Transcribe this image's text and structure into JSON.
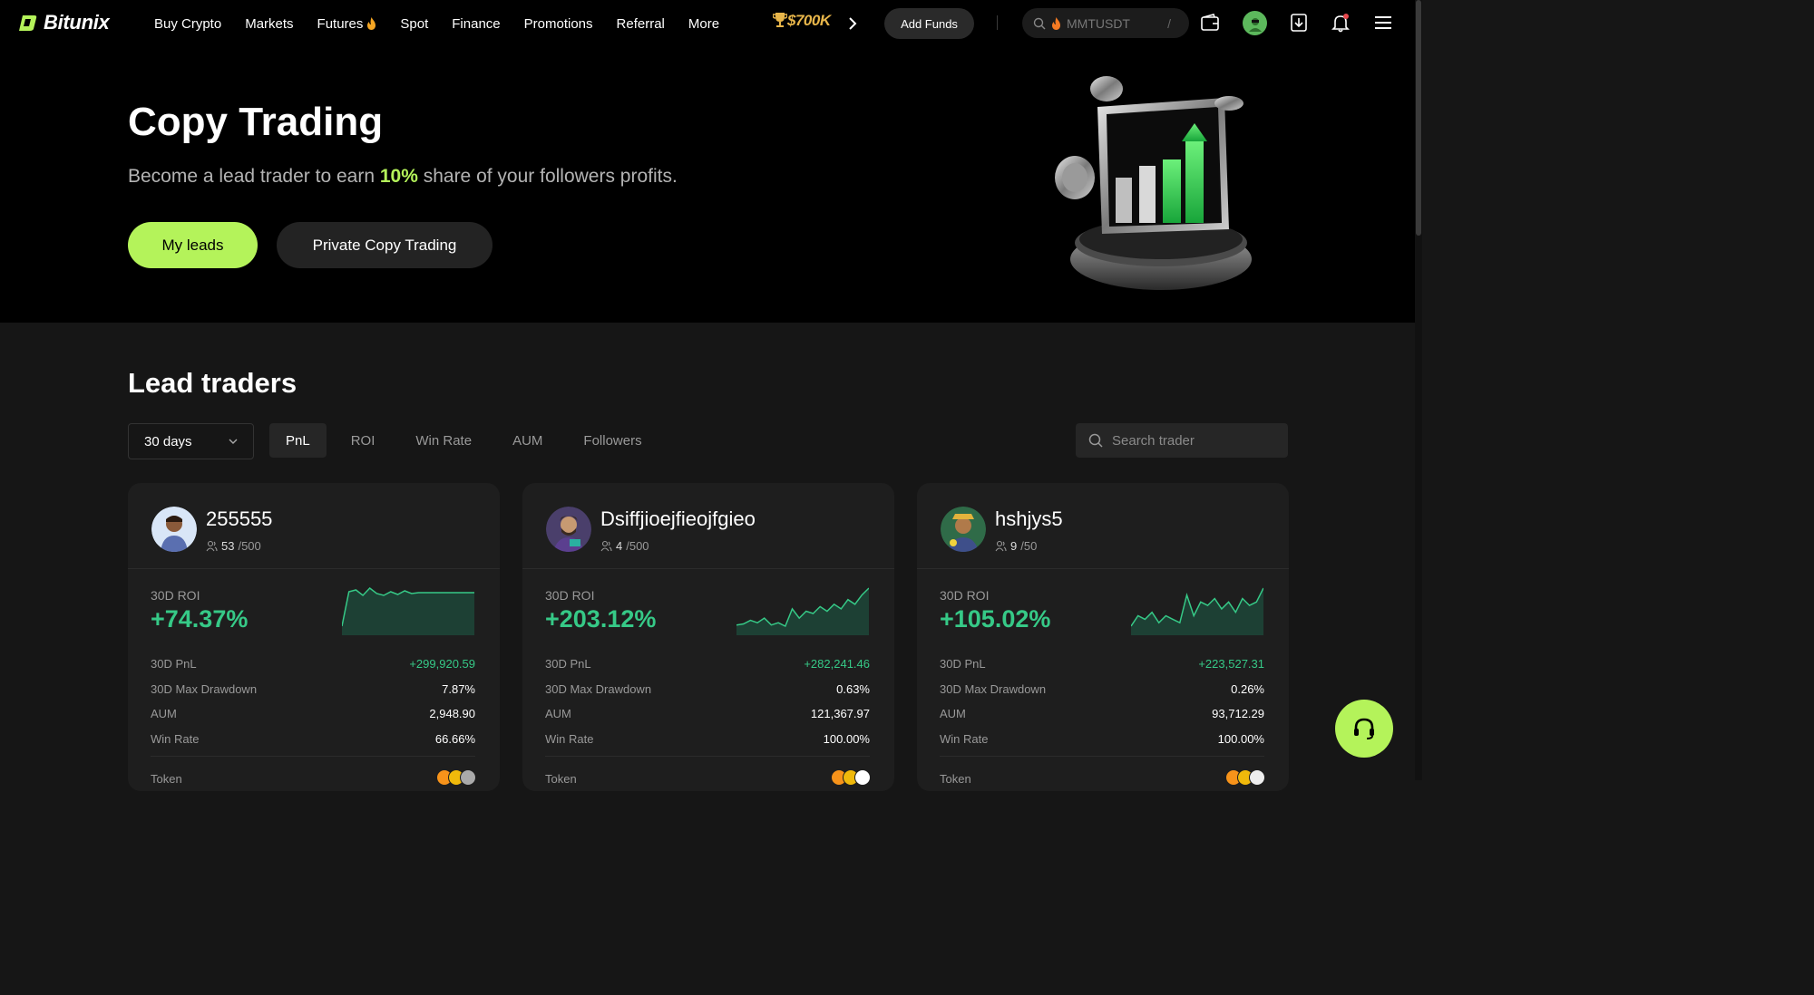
{
  "brand": {
    "name": "Bitunix"
  },
  "nav": {
    "items": [
      {
        "label": "Buy Crypto"
      },
      {
        "label": "Markets"
      },
      {
        "label": "Futures",
        "badge_icon": "fire-icon"
      },
      {
        "label": "Spot"
      },
      {
        "label": "Finance"
      },
      {
        "label": "Promotions"
      },
      {
        "label": "Referral"
      },
      {
        "label": "More"
      }
    ],
    "promo_text": "$700K",
    "add_funds_label": "Add Funds",
    "search_placeholder": "MMTUSDT",
    "search_shortcut": "/"
  },
  "hero": {
    "title": "Copy Trading",
    "subtitle_prefix": "Become a lead trader to earn ",
    "subtitle_highlight": "10%",
    "subtitle_suffix": " share of your followers profits.",
    "my_leads_label": "My leads",
    "private_label": "Private Copy Trading"
  },
  "lead_traders": {
    "title": "Lead traders",
    "period": "30 days",
    "tabs": [
      "PnL",
      "ROI",
      "Win Rate",
      "AUM",
      "Followers"
    ],
    "active_tab": "PnL",
    "search_placeholder": "Search trader",
    "cards": [
      {
        "name": "255555",
        "followers_current": "53",
        "followers_max": "/500",
        "roi_label": "30D ROI",
        "roi_value": "+74.37%",
        "pnl_label": "30D PnL",
        "pnl_value": "+299,920.59",
        "drawdown_label": "30D Max Drawdown",
        "drawdown_value": "7.87%",
        "aum_label": "AUM",
        "aum_value": "2,948.90",
        "winrate_label": "Win Rate",
        "winrate_value": "66.66%",
        "token_label": "Token",
        "sparkline": [
          2,
          40,
          42,
          36,
          44,
          38,
          36,
          40,
          37,
          41,
          38,
          39,
          39,
          39,
          39,
          39,
          39,
          39,
          39,
          39
        ]
      },
      {
        "name": "Dsiffjioejfieojfgieo",
        "followers_current": "4",
        "followers_max": "/500",
        "roi_label": "30D ROI",
        "roi_value": "+203.12%",
        "pnl_label": "30D PnL",
        "pnl_value": "+282,241.46",
        "drawdown_label": "30D Max Drawdown",
        "drawdown_value": "0.63%",
        "aum_label": "AUM",
        "aum_value": "121,367.97",
        "winrate_label": "Win Rate",
        "winrate_value": "100.00%",
        "token_label": "Token",
        "sparkline": [
          8,
          9,
          12,
          10,
          14,
          8,
          10,
          7,
          22,
          14,
          20,
          18,
          24,
          20,
          26,
          22,
          30,
          26,
          34,
          40
        ]
      },
      {
        "name": "hshjys5",
        "followers_current": "9",
        "followers_max": "/50",
        "roi_label": "30D ROI",
        "roi_value": "+105.02%",
        "pnl_label": "30D PnL",
        "pnl_value": "+223,527.31",
        "drawdown_label": "30D Max Drawdown",
        "drawdown_value": "0.26%",
        "aum_label": "AUM",
        "aum_value": "93,712.29",
        "winrate_label": "Win Rate",
        "winrate_value": "100.00%",
        "token_label": "Token",
        "sparkline": [
          24,
          30,
          28,
          32,
          26,
          30,
          28,
          26,
          42,
          30,
          38,
          36,
          40,
          34,
          38,
          32,
          40,
          36,
          38,
          46
        ]
      }
    ]
  },
  "colors": {
    "accent": "#b4f35a",
    "positive": "#36c987",
    "background": "#161616",
    "card": "#1e1e1e"
  }
}
